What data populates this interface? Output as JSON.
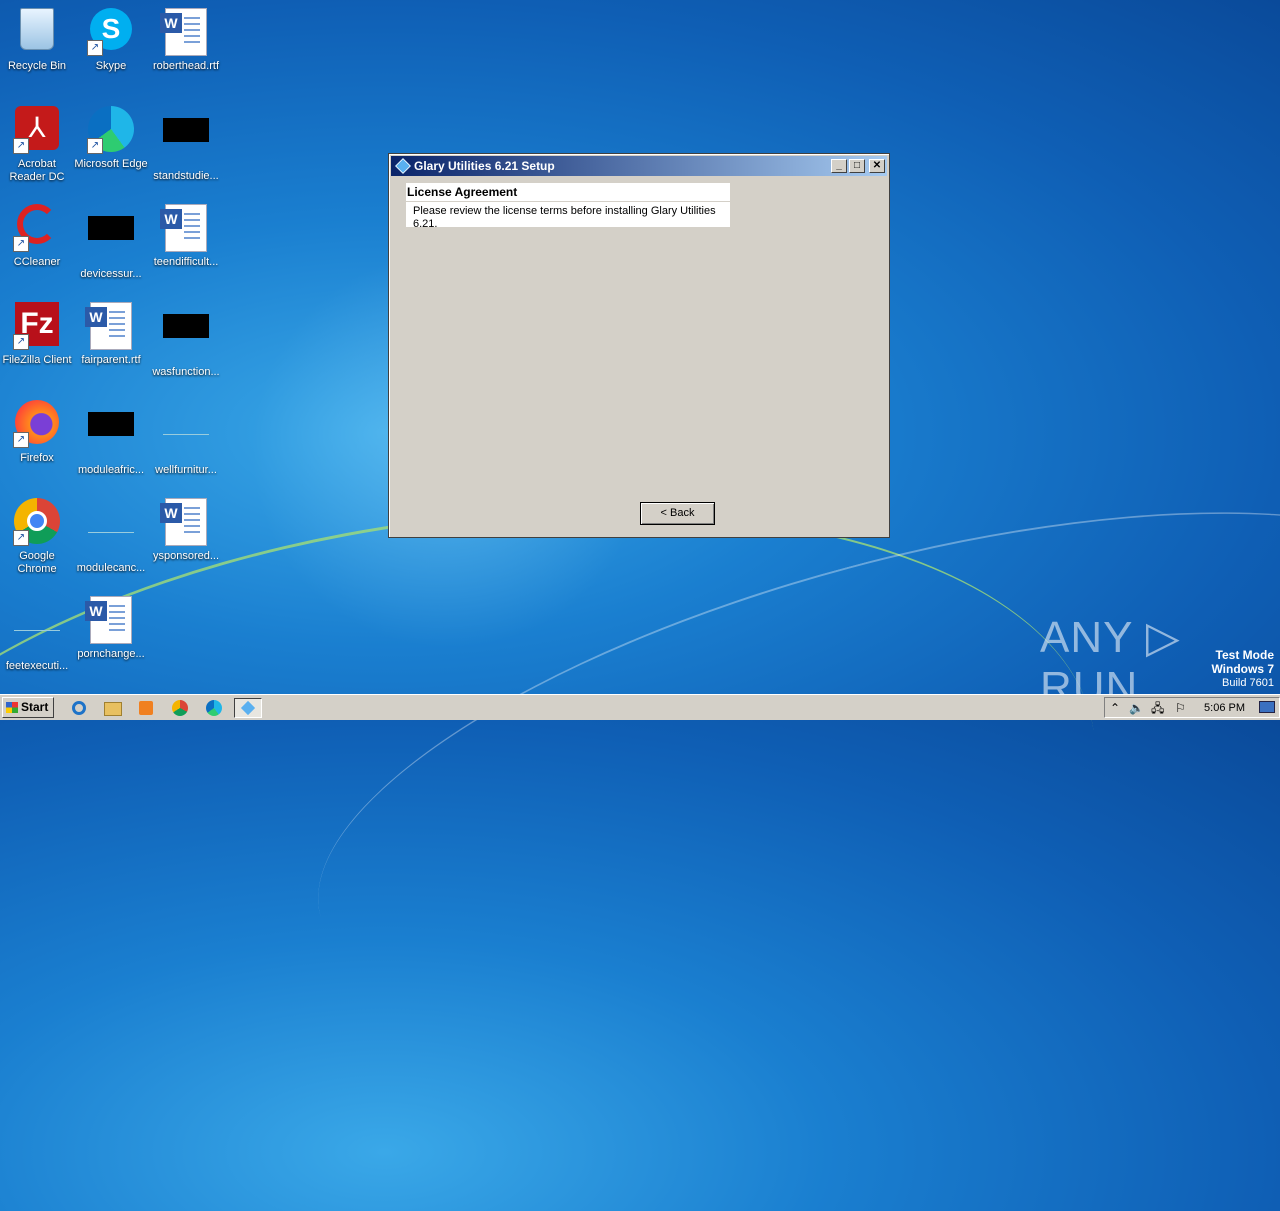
{
  "desktop": {
    "icons": [
      {
        "label": "Recycle Bin"
      },
      {
        "label": "Skype"
      },
      {
        "label": "roberthead.rtf"
      },
      {
        "label": "Acrobat Reader DC"
      },
      {
        "label": "Microsoft Edge"
      },
      {
        "label": "standstudie..."
      },
      {
        "label": "CCleaner"
      },
      {
        "label": "devicessur..."
      },
      {
        "label": "teendifficult..."
      },
      {
        "label": "FileZilla Client"
      },
      {
        "label": "fairparent.rtf"
      },
      {
        "label": "wasfunction..."
      },
      {
        "label": "Firefox"
      },
      {
        "label": "moduleafric..."
      },
      {
        "label": "wellfurnitur..."
      },
      {
        "label": "Google Chrome"
      },
      {
        "label": "modulecanc..."
      },
      {
        "label": "ysponsored..."
      },
      {
        "label": "feetexecuti..."
      },
      {
        "label": "pornchange..."
      }
    ]
  },
  "dialog": {
    "title": "Glary Utilities 6.21 Setup",
    "header_title": "License Agreement",
    "header_subtitle": "Please review the license terms before installing Glary Utilities 6.21.",
    "back_label": "< Back",
    "min_glyph": "_",
    "max_glyph": "□",
    "close_glyph": "✕"
  },
  "watermark": {
    "brand": "ANY ▷ RUN",
    "line1": "Test Mode",
    "line2": "Windows 7",
    "line3": "Build 7601"
  },
  "taskbar": {
    "start_label": "Start",
    "clock": "5:06 PM",
    "tray_expand_glyph": "⌃"
  }
}
